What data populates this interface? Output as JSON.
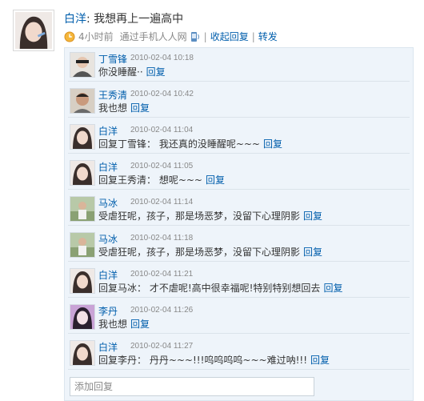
{
  "status": {
    "author": "白洋",
    "colon": ":",
    "text": "我想再上一遍高中",
    "time": "4小时前",
    "via": "通过手机人人网",
    "sep1": "|",
    "collapse_label": "收起回复",
    "sep2": "|",
    "share_label": "转发",
    "clock_icon": "clock-icon",
    "phone_icon": "phone-icon"
  },
  "replies": [
    {
      "name": "丁雪锋",
      "time": "2010-02-04 10:18",
      "text": "你没睡醒··",
      "reply_label": "回复"
    },
    {
      "name": "王秀清",
      "time": "2010-02-04 10:42",
      "text": "我也想",
      "reply_label": "回复"
    },
    {
      "name": "白洋",
      "time": "2010-02-04 11:04",
      "text": "回复丁雪锋： 我还真的没睡醒呢~~~",
      "reply_label": "回复"
    },
    {
      "name": "白洋",
      "time": "2010-02-04 11:05",
      "text": "回复王秀清： 想呢~~~",
      "reply_label": "回复"
    },
    {
      "name": "马冰",
      "time": "2010-02-04 11:14",
      "text": "受虐狂呢，孩子，那是场恶梦，没留下心理阴影",
      "reply_label": "回复"
    },
    {
      "name": "马冰",
      "time": "2010-02-04 11:18",
      "text": "受虐狂呢，孩子，那是场恶梦，没留下心理阴影",
      "reply_label": "回复"
    },
    {
      "name": "白洋",
      "time": "2010-02-04 11:21",
      "text": "回复马冰： 才不虐呢!高中很幸福呢!特别特别想回去",
      "reply_label": "回复"
    },
    {
      "name": "李丹",
      "time": "2010-02-04 11:26",
      "text": "我也想",
      "reply_label": "回复"
    },
    {
      "name": "白洋",
      "time": "2010-02-04 11:27",
      "text": "回复李丹： 丹丹~~~!!!呜呜呜呜~~~难过呐!!!",
      "reply_label": "回复"
    }
  ],
  "reply_box": {
    "placeholder": "添加回复"
  },
  "colors": {
    "link": "#005eac",
    "panel_bg": "#eef4fa",
    "meta": "#888888"
  }
}
